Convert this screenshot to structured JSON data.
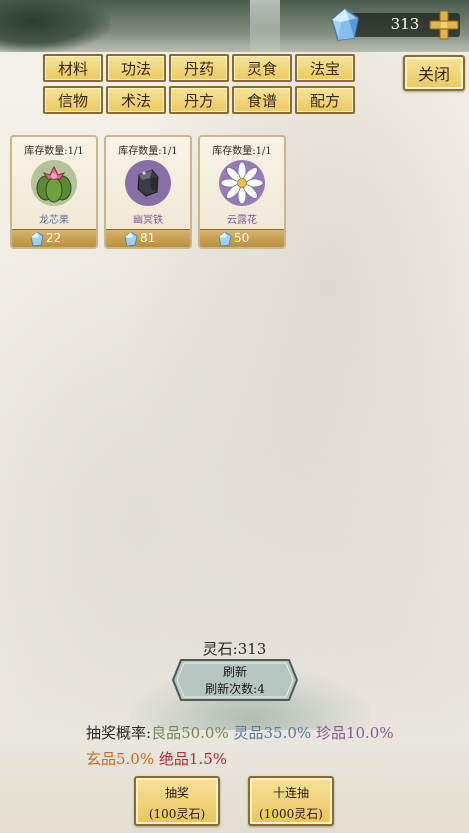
{
  "currency": {
    "value": "313"
  },
  "tabs": [
    {
      "label": "材料"
    },
    {
      "label": "功法"
    },
    {
      "label": "丹药"
    },
    {
      "label": "灵食"
    },
    {
      "label": "法宝"
    },
    {
      "label": "信物"
    },
    {
      "label": "术法"
    },
    {
      "label": "丹方"
    },
    {
      "label": "食谱"
    },
    {
      "label": "配方"
    }
  ],
  "close_label": "关闭",
  "items": [
    {
      "stock": "库存数量:1/1",
      "name": "龙芯果",
      "name_color": "#5a7a98",
      "price": "22",
      "icon": "dragon-heart-fruit-icon"
    },
    {
      "stock": "库存数量:1/1",
      "name": "幽冥铁",
      "name_color": "#8a5a9a",
      "price": "81",
      "icon": "netherworld-iron-icon"
    },
    {
      "stock": "库存数量:1/1",
      "name": "云露花",
      "name_color": "#8a5a9a",
      "price": "50",
      "icon": "cloud-dew-flower-icon"
    }
  ],
  "stone_label": "灵石:313",
  "refresh": {
    "title": "刷新",
    "count": "刷新次数:4"
  },
  "probability": {
    "prefix": "抽奖概率:",
    "good": "良品50.0%",
    "ling": "灵品35.0%",
    "zhen": "珍品10.0%",
    "xuan": "玄品5.0%",
    "jue": "绝品1.5%"
  },
  "draw_single": {
    "label": "抽奖",
    "cost": "(100灵石)"
  },
  "draw_ten": {
    "label": "十连抽",
    "cost": "(1000灵石)"
  },
  "colors": {
    "gold": "#ebc960",
    "gold_border": "#8a6a30",
    "gem": "#7fb4e8"
  }
}
